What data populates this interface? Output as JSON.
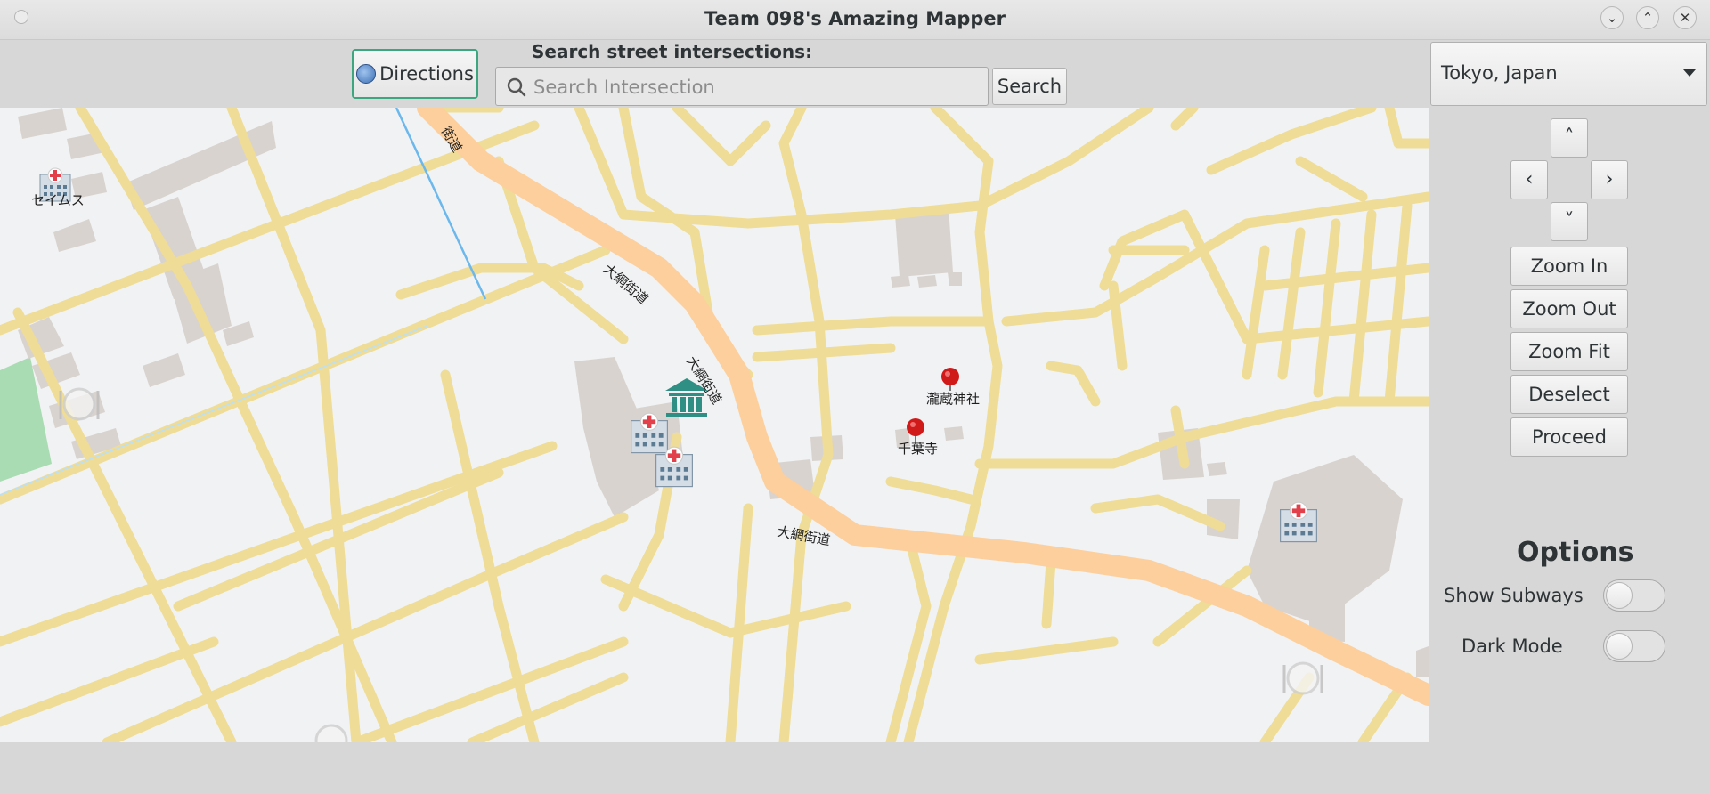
{
  "window": {
    "title": "Team 098's Amazing Mapper",
    "controls": [
      "minimize",
      "maximize",
      "close"
    ]
  },
  "toolbar": {
    "directions_label": "Directions",
    "search_label": "Search street intersections:",
    "search_placeholder": "Search Intersection",
    "search_value": "",
    "search_button": "Search"
  },
  "city_select": {
    "selected": "Tokyo, Japan"
  },
  "navigation": {
    "up": "˄",
    "left": "‹",
    "right": "›",
    "down": "˅"
  },
  "buttons": {
    "zoom_in": "Zoom In",
    "zoom_out": "Zoom Out",
    "zoom_fit": "Zoom Fit",
    "deselect": "Deselect",
    "proceed": "Proceed"
  },
  "options": {
    "title": "Options",
    "show_subways": {
      "label": "Show Subways",
      "on": false
    },
    "dark_mode": {
      "label": "Dark Mode",
      "on": false
    }
  },
  "map": {
    "colors": {
      "background": "#f1f2f4",
      "road": "#efdc96",
      "major_road": "#fccf9c",
      "building": "#d9d3cf",
      "park": "#a9dcb3",
      "water": "#6cb8ec",
      "pin": "#d01a1a"
    },
    "poi_labels": {
      "hospital_left": "セイムス",
      "shrine": "瀧蔵神社",
      "temple": "千葉寺"
    },
    "road_labels": {
      "r1": "街道",
      "r2": "大網街道",
      "r3": "大網街道",
      "r4": "大網街道"
    }
  }
}
